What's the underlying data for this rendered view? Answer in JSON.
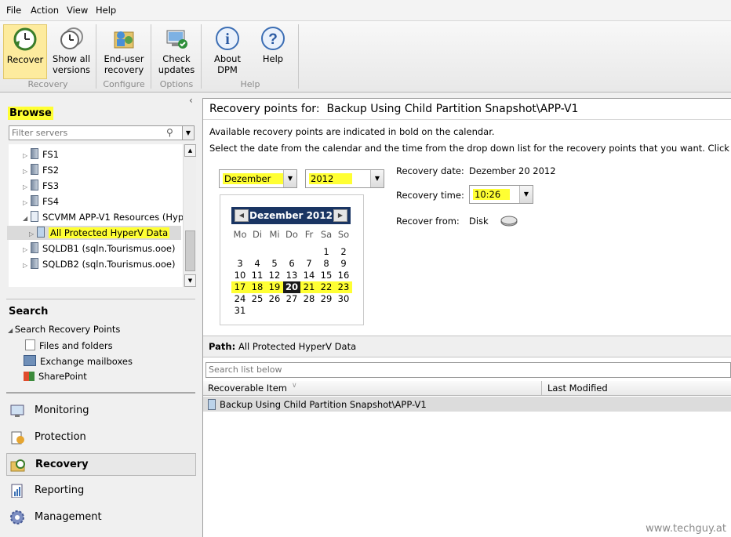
{
  "menu": [
    "File",
    "Action",
    "View",
    "Help"
  ],
  "ribbon": {
    "buttons": [
      {
        "line1": "Recover",
        "line2": "",
        "icon": "recover-clock-icon"
      },
      {
        "line1": "Show all",
        "line2": "versions",
        "icon": "versions-clock-icon"
      },
      {
        "line1": "End-user",
        "line2": "recovery",
        "icon": "end-user-recovery-icon"
      },
      {
        "line1": "Check",
        "line2": "updates",
        "icon": "check-updates-icon"
      },
      {
        "line1": "About",
        "line2": "DPM",
        "icon": "info-icon"
      },
      {
        "line1": "Help",
        "line2": "",
        "icon": "help-icon"
      }
    ],
    "groups": [
      "Recovery",
      "Configure",
      "Options",
      "Help"
    ]
  },
  "browse": {
    "title": "Browse",
    "filter_placeholder": "Filter servers",
    "tree": [
      {
        "label": "FS1"
      },
      {
        "label": "FS2"
      },
      {
        "label": "FS3"
      },
      {
        "label": "FS4"
      },
      {
        "label": "SCVMM APP-V1 Resources (Hyp"
      },
      {
        "label": "All Protected HyperV Data"
      },
      {
        "label": "SQLDB1 (sqln.Tourismus.ooe)"
      },
      {
        "label": "SQLDB2 (sqln.Tourismus.ooe)"
      }
    ]
  },
  "search": {
    "title": "Search",
    "items": [
      "Search Recovery Points",
      "Files and folders",
      "Exchange mailboxes",
      "SharePoint"
    ]
  },
  "nav": [
    "Monitoring",
    "Protection",
    "Recovery",
    "Reporting",
    "Management"
  ],
  "recovery": {
    "header_label": "Recovery points for:",
    "header_value": "Backup Using Child Partition Snapshot\\APP-V1",
    "info1": "Available recovery points are indicated in bold on the calendar.",
    "info2": "Select the date from the calendar and the time from the drop down list for the recovery points that you want. Click recover in the",
    "month": "Dezember",
    "year": "2012",
    "date_label": "Recovery date:",
    "date_value": "Dezember 20 2012",
    "time_label": "Recovery time:",
    "time_value": "10:26",
    "from_label": "Recover from:",
    "from_value": "Disk"
  },
  "calendar": {
    "title": "Dezember 2012",
    "dow": [
      "Mo",
      "Di",
      "Mi",
      "Do",
      "Fr",
      "Sa",
      "So"
    ],
    "weeks": [
      [
        "",
        "",
        "",
        "",
        "",
        "1",
        "2"
      ],
      [
        "3",
        "4",
        "5",
        "6",
        "7",
        "8",
        "9"
      ],
      [
        "10",
        "11",
        "12",
        "13",
        "14",
        "15",
        "16"
      ],
      [
        "17",
        "18",
        "19",
        "20",
        "21",
        "22",
        "23"
      ],
      [
        "24",
        "25",
        "26",
        "27",
        "28",
        "29",
        "30"
      ],
      [
        "31",
        "",
        "",
        "",
        "",
        "",
        ""
      ]
    ],
    "selected": "20",
    "bold_days": [
      "17",
      "18",
      "19",
      "20",
      "21",
      "22",
      "23"
    ]
  },
  "path": {
    "label": "Path:",
    "value": "All Protected HyperV Data"
  },
  "list": {
    "search_placeholder": "Search list below",
    "col1": "Recoverable Item",
    "col2": "Last Modified",
    "rows": [
      {
        "name": "Backup Using Child Partition Snapshot\\APP-V1",
        "modified": ""
      }
    ]
  },
  "watermark": "www.techguy.at",
  "colors": {
    "highlight": "#ffff33",
    "calendar_header": "#1a3563",
    "selected_nav": "#e8e8e8"
  }
}
